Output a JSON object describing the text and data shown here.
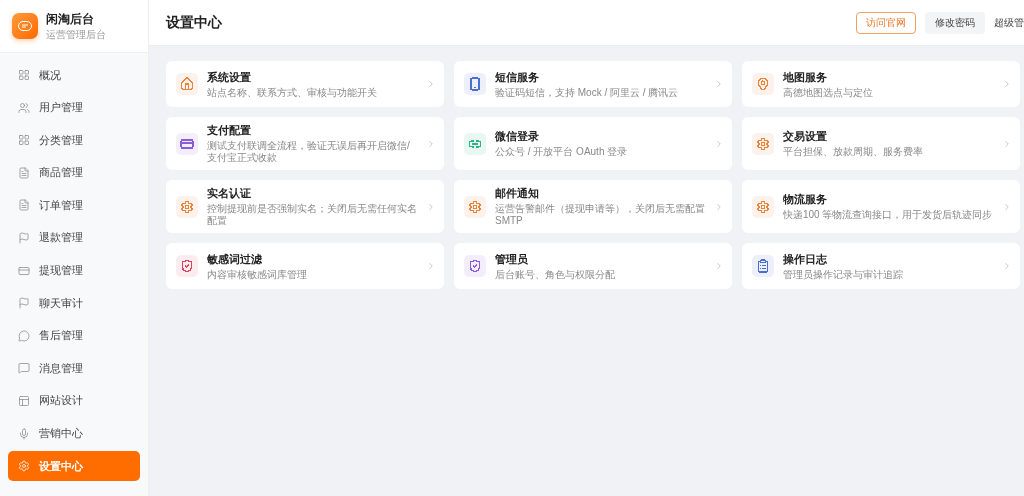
{
  "brand": {
    "name": "闲淘后台",
    "subtitle": "运营管理后台"
  },
  "sidebar": {
    "items": [
      {
        "label": "概况",
        "kind": "grid",
        "selected": false
      },
      {
        "label": "用户管理",
        "kind": "users",
        "selected": false
      },
      {
        "label": "分类管理",
        "kind": "grid",
        "selected": false
      },
      {
        "label": "商品管理",
        "kind": "file",
        "selected": false
      },
      {
        "label": "订单管理",
        "kind": "file",
        "selected": false
      },
      {
        "label": "退款管理",
        "kind": "flag",
        "selected": false
      },
      {
        "label": "提现管理",
        "kind": "card",
        "selected": false
      },
      {
        "label": "聊天审计",
        "kind": "flag",
        "selected": false
      },
      {
        "label": "售后管理",
        "kind": "chat",
        "selected": false
      },
      {
        "label": "消息管理",
        "kind": "message",
        "selected": false
      },
      {
        "label": "网站设计",
        "kind": "layout",
        "selected": false
      },
      {
        "label": "营销中心",
        "kind": "mic",
        "selected": false
      },
      {
        "label": "设置中心",
        "kind": "gear",
        "selected": true
      }
    ]
  },
  "header": {
    "title": "设置中心",
    "buttons": [
      {
        "label": "访问官网",
        "kind": "outline"
      },
      {
        "label": "修改密码",
        "kind": "plain"
      }
    ],
    "user": "超级管"
  },
  "cards": [
    {
      "title": "系统设置",
      "description": "站点名称、联系方式、审核与功能开关",
      "kind": "home",
      "color": "#e8843c"
    },
    {
      "title": "短信服务",
      "description": "验证码短信，支持 Mock / 阿里云 / 腾讯云",
      "kind": "phone",
      "color": "#4a6fd1"
    },
    {
      "title": "地图服务",
      "description": "高德地图选点与定位",
      "kind": "pin",
      "color": "#e8843c"
    },
    {
      "title": "支付配置",
      "description": "测试支付联调全流程，验证无误后再开启微信/支付宝正式收款",
      "kind": "card",
      "color": "#8a5cd6"
    },
    {
      "title": "微信登录",
      "description": "公众号 / 开放平台 OAuth 登录",
      "kind": "wechat",
      "color": "#2bb58a"
    },
    {
      "title": "交易设置",
      "description": "平台担保、放款周期、服务费率",
      "kind": "gear",
      "color": "#e8843c"
    },
    {
      "title": "实名认证",
      "description": "控制提现前是否强制实名；关闭后无需任何实名配置",
      "kind": "gear",
      "color": "#e8843c"
    },
    {
      "title": "邮件通知",
      "description": "运营告警邮件（提现申请等），关闭后无需配置 SMTP",
      "kind": "gear",
      "color": "#e8843c"
    },
    {
      "title": "物流服务",
      "description": "快递100 等物流查询接口，用于发货后轨迹同步",
      "kind": "gear",
      "color": "#e8843c"
    },
    {
      "title": "敏感词过滤",
      "description": "内容审核敏感词库管理",
      "kind": "shield",
      "color": "#d9455f"
    },
    {
      "title": "管理员",
      "description": "后台账号、角色与权限分配",
      "kind": "shield",
      "color": "#8a5cd6"
    },
    {
      "title": "操作日志",
      "description": "管理员操作记录与审计追踪",
      "kind": "clipboard",
      "color": "#4a6fd1"
    }
  ]
}
